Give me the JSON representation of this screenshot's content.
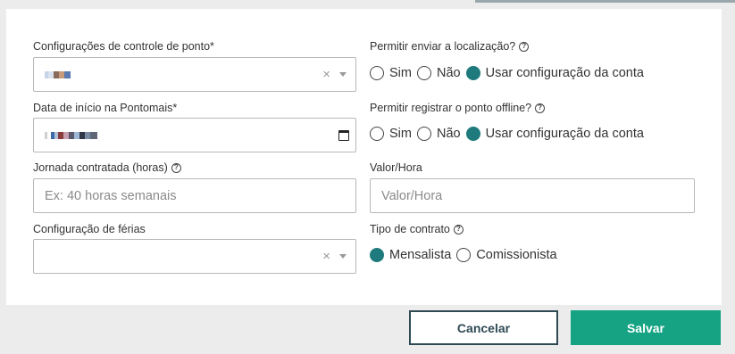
{
  "form": {
    "ponto_config": {
      "label": "Configurações de controle de ponto*",
      "clear": "×"
    },
    "data_inicio": {
      "label": "Data de início na Pontomais*"
    },
    "jornada": {
      "label": "Jornada contratada (horas)",
      "placeholder": "Ex: 40 horas semanais"
    },
    "ferias": {
      "label": "Configuração de férias",
      "clear": "×"
    },
    "localizacao": {
      "label": "Permitir enviar a localização?",
      "options": [
        "Sim",
        "Não",
        "Usar configuração da conta"
      ],
      "selected": "Usar configuração da conta"
    },
    "offline": {
      "label": "Permitir registrar o ponto offline?",
      "options": [
        "Sim",
        "Não",
        "Usar configuração da conta"
      ],
      "selected": "Usar configuração da conta"
    },
    "valor_hora": {
      "label": "Valor/Hora",
      "placeholder": "Valor/Hora"
    },
    "tipo_contrato": {
      "label": "Tipo de contrato",
      "options": [
        "Mensalista",
        "Comissionista"
      ],
      "selected": "Mensalista"
    }
  },
  "icons": {
    "help": "?",
    "help_icon_name": "help-circle-icon",
    "clear_icon_name": "close-icon",
    "caret_icon_name": "chevron-down-icon",
    "calendar_icon_name": "calendar-icon"
  },
  "actions": {
    "cancel_label": "Cancelar",
    "save_label": "Salvar"
  },
  "colors": {
    "primary_green": "#15a383",
    "radio_checked": "#1e7a7c",
    "cancel_border": "#2f4a55"
  }
}
